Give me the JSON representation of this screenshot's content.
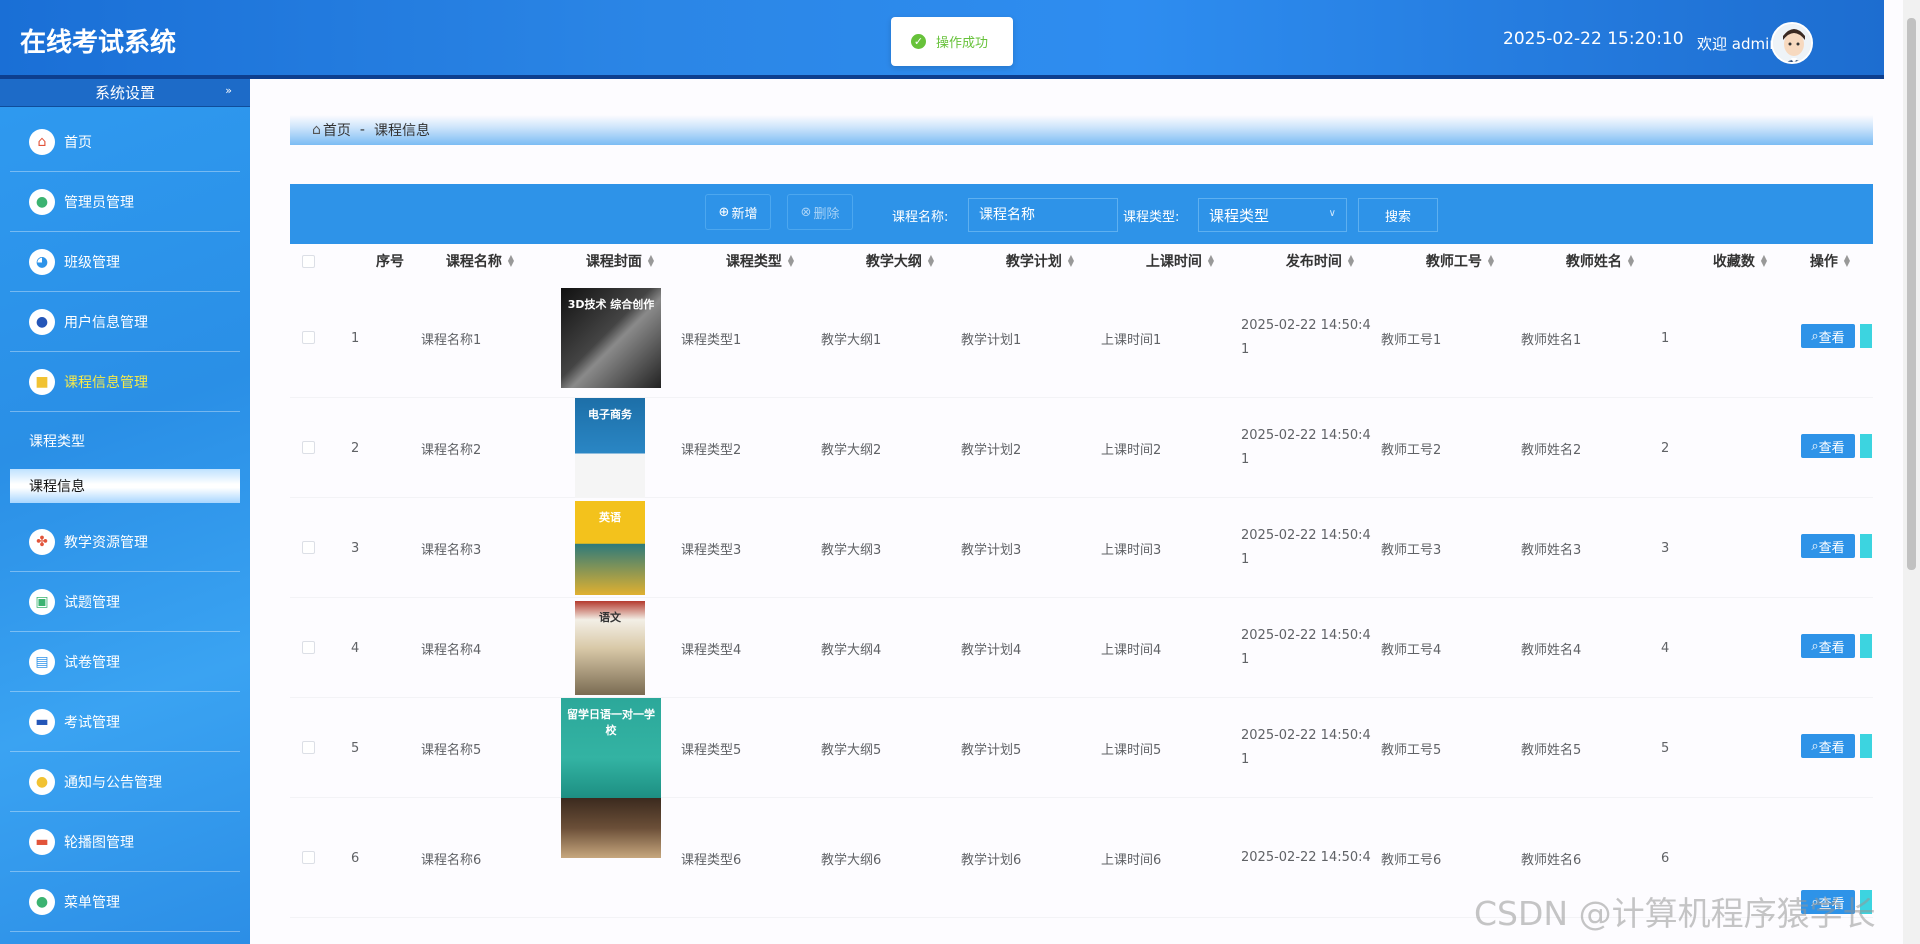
{
  "header": {
    "app_title": "在线考试系统",
    "datetime": "2025-02-22 15:20:10",
    "welcome": "欢迎 admin"
  },
  "toast": {
    "text": "操作成功",
    "icon": "check-circle-icon"
  },
  "sidebar": {
    "header": "系统设置",
    "toggle": "»",
    "items": [
      {
        "label": "首页",
        "icon": "home-icon"
      },
      {
        "label": "管理员管理",
        "icon": "admin-icon"
      },
      {
        "label": "班级管理",
        "icon": "class-icon"
      },
      {
        "label": "用户信息管理",
        "icon": "user-icon"
      },
      {
        "label": "课程信息管理",
        "icon": "course-icon",
        "active": true
      },
      {
        "label": "教学资源管理",
        "icon": "resource-icon"
      },
      {
        "label": "试题管理",
        "icon": "question-icon"
      },
      {
        "label": "试卷管理",
        "icon": "paper-icon"
      },
      {
        "label": "考试管理",
        "icon": "exam-icon"
      },
      {
        "label": "通知与公告管理",
        "icon": "notice-icon"
      },
      {
        "label": "轮播图管理",
        "icon": "carousel-icon"
      },
      {
        "label": "菜单管理",
        "icon": "menu-icon"
      }
    ],
    "sub_items": [
      {
        "label": "课程类型"
      },
      {
        "label": "课程信息",
        "selected": true
      }
    ]
  },
  "breadcrumb": {
    "home": "首页",
    "separator": "-",
    "current": "课程信息"
  },
  "toolbar": {
    "add_label": "新增",
    "delete_label": "删除",
    "name_label": "课程名称:",
    "name_placeholder": "课程名称",
    "type_label": "课程类型:",
    "type_value": "课程类型",
    "search_label": "搜索"
  },
  "table": {
    "columns": [
      "序号",
      "课程名称",
      "课程封面",
      "课程类型",
      "教学大纲",
      "教学计划",
      "上课时间",
      "发布时间",
      "教师工号",
      "教师姓名",
      "收藏数",
      "操作"
    ],
    "view_label": "查看",
    "rows": [
      {
        "no": "1",
        "name": "课程名称1",
        "type": "课程类型1",
        "syllabus": "教学大纲1",
        "plan": "教学计划1",
        "time": "上课时间1",
        "published": "2025-02-22 14:50:4",
        "published_2": "1",
        "teacher_id": "教师工号1",
        "teacher_name": "教师姓名1",
        "favs": "1",
        "cover_title": "3D技术 综合创作"
      },
      {
        "no": "2",
        "name": "课程名称2",
        "type": "课程类型2",
        "syllabus": "教学大纲2",
        "plan": "教学计划2",
        "time": "上课时间2",
        "published": "2025-02-22 14:50:4",
        "published_2": "1",
        "teacher_id": "教师工号2",
        "teacher_name": "教师姓名2",
        "favs": "2",
        "cover_title": "电子商务"
      },
      {
        "no": "3",
        "name": "课程名称3",
        "type": "课程类型3",
        "syllabus": "教学大纲3",
        "plan": "教学计划3",
        "time": "上课时间3",
        "published": "2025-02-22 14:50:4",
        "published_2": "1",
        "teacher_id": "教师工号3",
        "teacher_name": "教师姓名3",
        "favs": "3",
        "cover_title": "英语"
      },
      {
        "no": "4",
        "name": "课程名称4",
        "type": "课程类型4",
        "syllabus": "教学大纲4",
        "plan": "教学计划4",
        "time": "上课时间4",
        "published": "2025-02-22 14:50:4",
        "published_2": "1",
        "teacher_id": "教师工号4",
        "teacher_name": "教师姓名4",
        "favs": "4",
        "cover_title": "语文"
      },
      {
        "no": "5",
        "name": "课程名称5",
        "type": "课程类型5",
        "syllabus": "教学大纲5",
        "plan": "教学计划5",
        "time": "上课时间5",
        "published": "2025-02-22 14:50:4",
        "published_2": "1",
        "teacher_id": "教师工号5",
        "teacher_name": "教师姓名5",
        "favs": "5",
        "cover_title": "留学日语一对一学校"
      },
      {
        "no": "6",
        "name": "课程名称6",
        "type": "课程类型6",
        "syllabus": "教学大纲6",
        "plan": "教学计划6",
        "time": "上课时间6",
        "published": "2025-02-22 14:50:4",
        "published_2": "",
        "teacher_id": "教师工号6",
        "teacher_name": "教师姓名6",
        "favs": "6",
        "cover_title": ""
      }
    ]
  },
  "watermark": "CSDN @计算机程序猿学长"
}
